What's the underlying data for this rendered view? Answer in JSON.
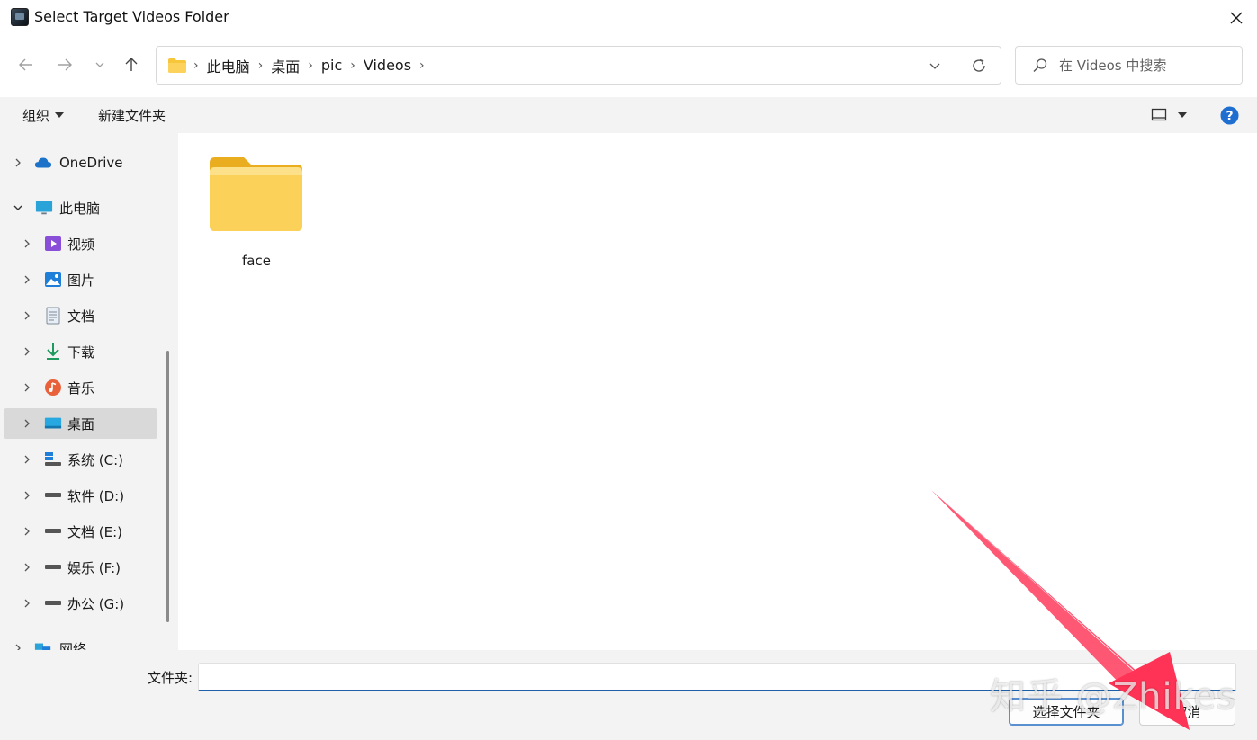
{
  "window": {
    "title": "Select Target Videos Folder"
  },
  "navigation": {
    "back": "back",
    "forward": "forward",
    "recent": "recent",
    "up": "up"
  },
  "address": {
    "crumbs": [
      "此电脑",
      "桌面",
      "pic",
      "Videos"
    ]
  },
  "search": {
    "placeholder": "在 Videos 中搜索"
  },
  "toolbar": {
    "organize": "组织",
    "new_folder": "新建文件夹"
  },
  "sidebar": {
    "items": [
      {
        "label": "OneDrive",
        "icon": "cloud-icon",
        "expanded": false
      },
      {
        "label": "此电脑",
        "icon": "computer-icon",
        "expanded": true
      },
      {
        "label": "视频",
        "icon": "video-icon"
      },
      {
        "label": "图片",
        "icon": "image-icon"
      },
      {
        "label": "文档",
        "icon": "document-icon"
      },
      {
        "label": "下载",
        "icon": "download-icon"
      },
      {
        "label": "音乐",
        "icon": "music-icon"
      },
      {
        "label": "桌面",
        "icon": "desktop-icon",
        "selected": true
      },
      {
        "label": "系统 (C:)",
        "icon": "system-drive-icon"
      },
      {
        "label": "软件 (D:)",
        "icon": "drive-icon"
      },
      {
        "label": "文档 (E:)",
        "icon": "drive-icon"
      },
      {
        "label": "娱乐 (F:)",
        "icon": "drive-icon"
      },
      {
        "label": "办公 (G:)",
        "icon": "drive-icon"
      },
      {
        "label": "网络",
        "icon": "network-icon"
      }
    ]
  },
  "content": {
    "items": [
      {
        "name": "face",
        "type": "folder"
      }
    ]
  },
  "footer": {
    "folder_label": "文件夹:",
    "folder_value": "",
    "select_button": "选择文件夹",
    "cancel_button": "取消"
  },
  "overlay": {
    "watermark": "知乎 @Zhikes"
  },
  "colors": {
    "accent": "#1f5fa8",
    "folder": "#f8c63b",
    "arrow": "#ff3b5c",
    "help": "#1f6fd1"
  }
}
